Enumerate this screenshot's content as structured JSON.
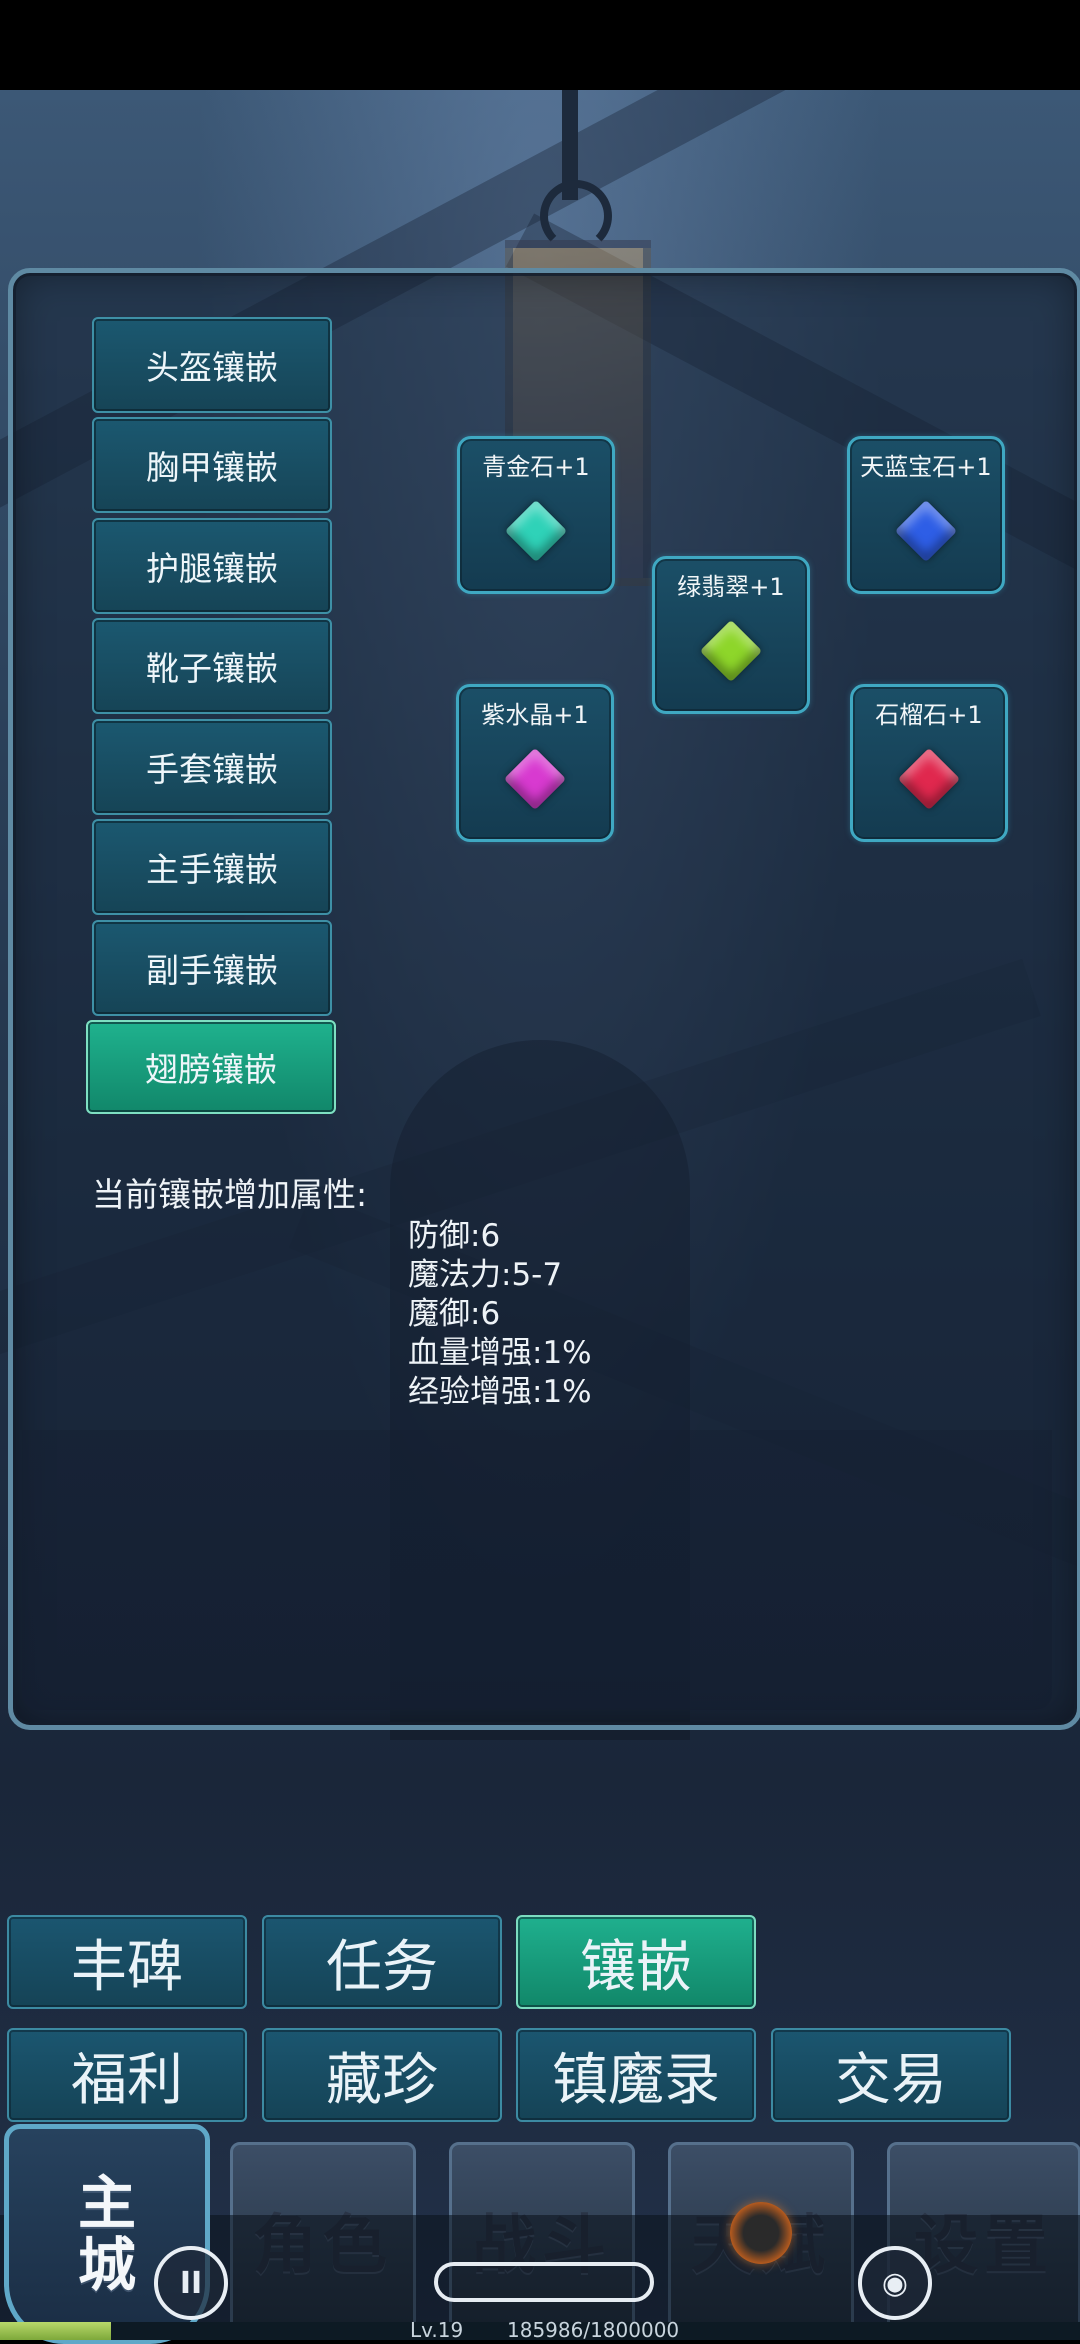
{
  "slots": [
    {
      "label": "头盔镶嵌",
      "active": false
    },
    {
      "label": "胸甲镶嵌",
      "active": false
    },
    {
      "label": "护腿镶嵌",
      "active": false
    },
    {
      "label": "靴子镶嵌",
      "active": false
    },
    {
      "label": "手套镶嵌",
      "active": false
    },
    {
      "label": "主手镶嵌",
      "active": false
    },
    {
      "label": "副手镶嵌",
      "active": false
    },
    {
      "label": "翅膀镶嵌",
      "active": true
    }
  ],
  "gems": [
    {
      "label": "青金石+1",
      "color": "#2fd2b8"
    },
    {
      "label": "天蓝宝石+1",
      "color": "#2e5ee6"
    },
    {
      "label": "绿翡翠+1",
      "color": "#8ed62a"
    },
    {
      "label": "紫水晶+1",
      "color": "#d83ad0"
    },
    {
      "label": "石榴石+1",
      "color": "#e0284e"
    }
  ],
  "attributes": {
    "title": "当前镶嵌增加属性:",
    "lines": [
      "防御:6",
      "魔法力:5-7",
      "魔御:6",
      "血量增强:1%",
      "经验增强:1%"
    ]
  },
  "menu": {
    "row1": [
      {
        "label": "丰碑",
        "active": false
      },
      {
        "label": "任务",
        "active": false
      },
      {
        "label": "镶嵌",
        "active": true
      }
    ],
    "row2": [
      {
        "label": "福利",
        "active": false
      },
      {
        "label": "藏珍",
        "active": false
      },
      {
        "label": "镇魔录",
        "active": false
      },
      {
        "label": "交易",
        "active": false
      }
    ]
  },
  "nav": {
    "home": {
      "line1": "主",
      "line2": "城"
    },
    "tabs": [
      "角色",
      "战斗",
      "天赋",
      "设置"
    ]
  },
  "player": {
    "level": "Lv.19",
    "exp": "185986/1800000",
    "exp_fraction": 0.103
  },
  "colors": {
    "accent_active": "#1fb28e",
    "button_base": "#1b5870"
  }
}
